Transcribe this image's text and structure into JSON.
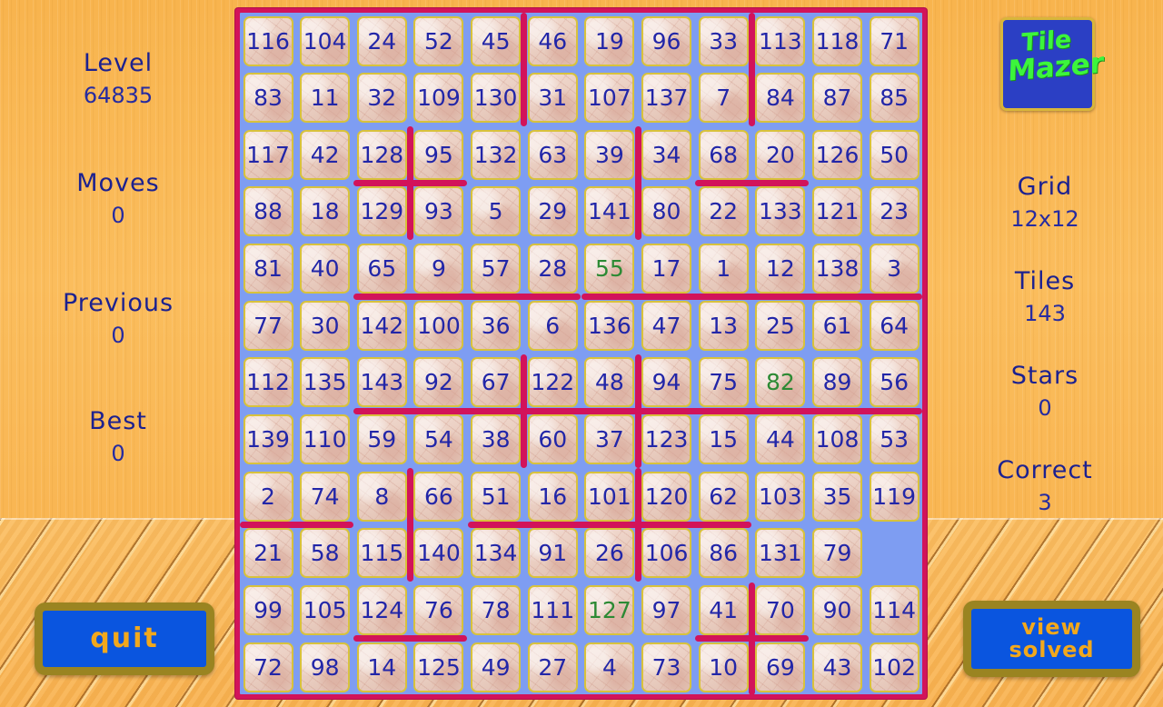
{
  "app": {
    "title": "Tile Mazer",
    "logo_line1": "Tile",
    "logo_line2": "Mazer"
  },
  "left_panel": {
    "stats": [
      {
        "label": "Level",
        "value": "64835"
      },
      {
        "label": "Moves",
        "value": "0"
      },
      {
        "label": "Previous",
        "value": "0"
      },
      {
        "label": "Best",
        "value": "0"
      }
    ],
    "quit_label": "quit"
  },
  "right_panel": {
    "stats": [
      {
        "label": "Grid",
        "value": "12x12"
      },
      {
        "label": "Tiles",
        "value": "143"
      },
      {
        "label": "Stars",
        "value": "0"
      },
      {
        "label": "Correct",
        "value": "3"
      }
    ],
    "view_solved_line1": "view",
    "view_solved_line2": "solved"
  },
  "colors": {
    "wall": "#D2135A",
    "board_bg": "#7E9DF2",
    "tile_border": "#D8C23C",
    "tile_number": "#2226A8",
    "tile_number_correct": "#2C8A34",
    "panel_text": "#1C2190",
    "button_fill": "#0A55DF",
    "button_border": "#9A8421",
    "button_text": "#F2A81C",
    "logo_bg": "#2B3FC4",
    "logo_text": "#3CF53C",
    "background_wall": "#F8B44E"
  },
  "board": {
    "rows": 12,
    "cols": 12,
    "grid": [
      [
        "116",
        "104",
        "24",
        "52",
        "45",
        "46",
        "19",
        "96",
        "33",
        "113",
        "118",
        "71"
      ],
      [
        "83",
        "11",
        "32",
        "109",
        "130",
        "31",
        "107",
        "137",
        "7",
        "84",
        "87",
        "85"
      ],
      [
        "117",
        "42",
        "128",
        "95",
        "132",
        "63",
        "39",
        "34",
        "68",
        "20",
        "126",
        "50"
      ],
      [
        "88",
        "18",
        "129",
        "93",
        "5",
        "29",
        "141",
        "80",
        "22",
        "133",
        "121",
        "23"
      ],
      [
        "81",
        "40",
        "65",
        "9",
        "57",
        "28",
        "55",
        "17",
        "1",
        "12",
        "138",
        "3"
      ],
      [
        "77",
        "30",
        "142",
        "100",
        "36",
        "6",
        "136",
        "47",
        "13",
        "25",
        "61",
        "64"
      ],
      [
        "112",
        "135",
        "143",
        "92",
        "67",
        "122",
        "48",
        "94",
        "75",
        "82",
        "89",
        "56"
      ],
      [
        "139",
        "110",
        "59",
        "54",
        "38",
        "60",
        "37",
        "123",
        "15",
        "44",
        "108",
        "53"
      ],
      [
        "2",
        "74",
        "8",
        "66",
        "51",
        "16",
        "101",
        "120",
        "62",
        "103",
        "35",
        "119"
      ],
      [
        "21",
        "58",
        "115",
        "140",
        "134",
        "91",
        "26",
        "106",
        "86",
        "131",
        "79",
        ""
      ],
      [
        "99",
        "105",
        "124",
        "76",
        "78",
        "111",
        "127",
        "97",
        "41",
        "70",
        "90",
        "114"
      ],
      [
        "72",
        "98",
        "14",
        "125",
        "49",
        "27",
        "4",
        "73",
        "10",
        "69",
        "43",
        "102"
      ]
    ],
    "correct_cells": [
      [
        4,
        6
      ],
      [
        6,
        9
      ],
      [
        10,
        6
      ]
    ],
    "empty_cell": [
      9,
      11
    ],
    "walls_horizontal": [
      {
        "row": 2,
        "col_start": 2,
        "col_end": 3
      },
      {
        "row": 2,
        "col_start": 8,
        "col_end": 9
      },
      {
        "row": 4,
        "col_start": 2,
        "col_end": 5
      },
      {
        "row": 4,
        "col_start": 6,
        "col_end": 11
      },
      {
        "row": 6,
        "col_start": 2,
        "col_end": 11
      },
      {
        "row": 8,
        "col_start": 4,
        "col_end": 8
      },
      {
        "row": 8,
        "col_start": 0,
        "col_end": 1
      },
      {
        "row": 10,
        "col_start": 2,
        "col_end": 3
      },
      {
        "row": 10,
        "col_start": 8,
        "col_end": 9
      }
    ],
    "walls_vertical": [
      {
        "col": 4,
        "row_start": 0,
        "row_end": 1
      },
      {
        "col": 8,
        "row_start": 0,
        "row_end": 1
      },
      {
        "col": 2,
        "row_start": 2,
        "row_end": 3
      },
      {
        "col": 6,
        "row_start": 2,
        "row_end": 3
      },
      {
        "col": 6,
        "row_start": 6,
        "row_end": 7
      },
      {
        "col": 4,
        "row_start": 6,
        "row_end": 7
      },
      {
        "col": 2,
        "row_start": 8,
        "row_end": 9
      },
      {
        "col": 6,
        "row_start": 8,
        "row_end": 9
      },
      {
        "col": 8,
        "row_start": 10,
        "row_end": 11
      }
    ]
  }
}
